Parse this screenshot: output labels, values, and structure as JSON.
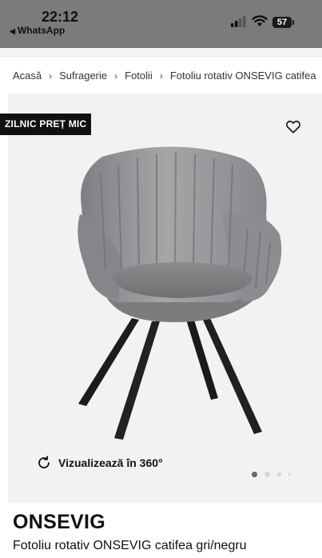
{
  "status_bar": {
    "time": "22:12",
    "back_app": "WhatsApp",
    "battery": "57"
  },
  "breadcrumb": [
    "Acasă",
    "Sufragerie",
    "Fotolii",
    "Fotoliu rotativ ONSEVIG catifea"
  ],
  "product": {
    "badge": "ZILNIC PREȚ MIC",
    "view_360_label": "Vizualizează în 360°",
    "brand": "ONSEVIG",
    "name": "Fotoliu rotativ ONSEVIG catifea gri/negru",
    "image_count_dots": 4,
    "active_image": 1
  },
  "colors": {
    "status_bar_bg": "#7b7b7b",
    "image_bg": "#f2f2f2",
    "badge_bg": "#111111",
    "chair_fabric": "#8f9092",
    "chair_legs": "#1c1c1c"
  }
}
